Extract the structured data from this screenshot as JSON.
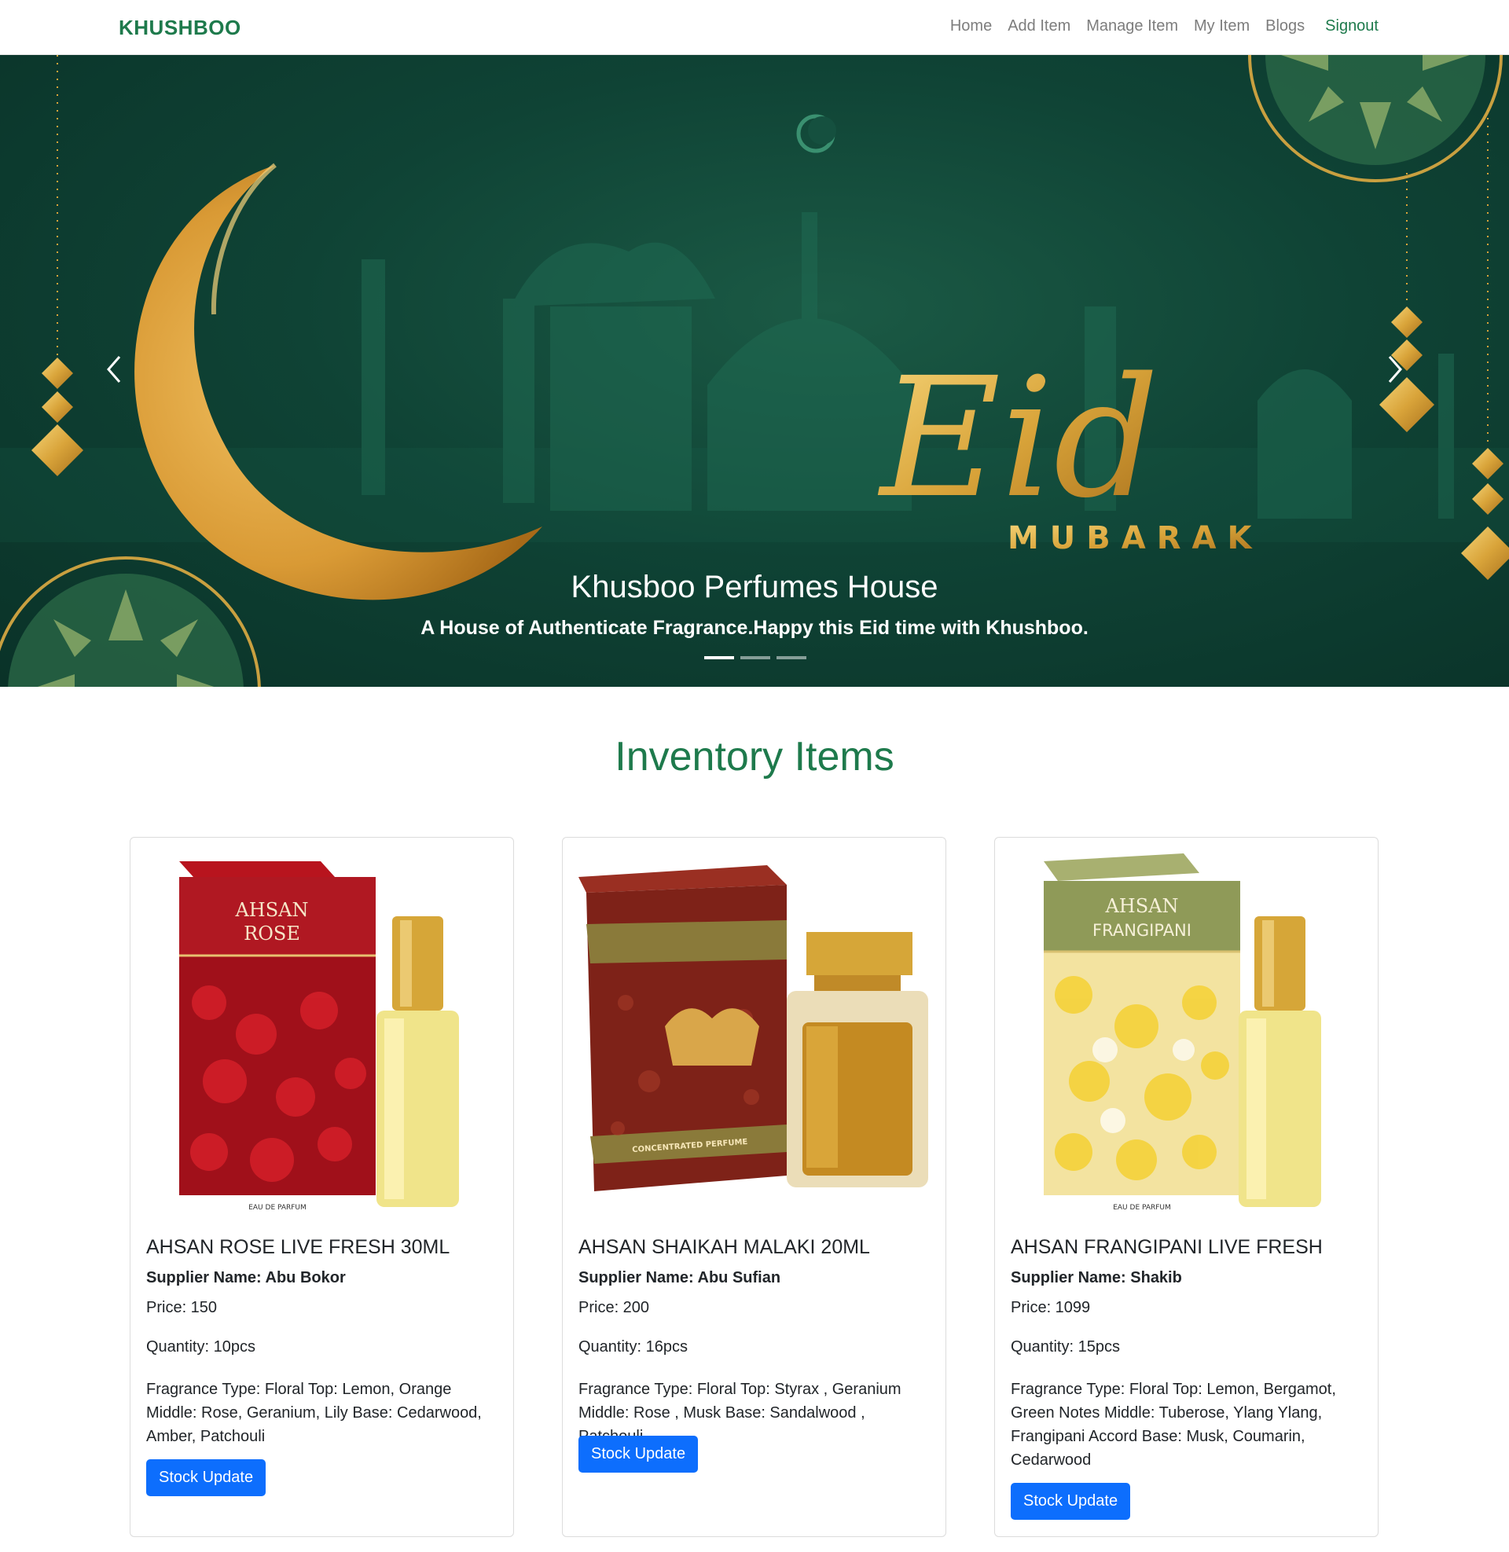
{
  "navbar": {
    "brand": "KHUSHBOO",
    "links": [
      "Home",
      "Add Item",
      "Manage Item",
      "My Item",
      "Blogs"
    ],
    "signout": "Signout"
  },
  "hero": {
    "banner_text_script": "Eid",
    "banner_text_caps": "MUBARAK",
    "caption_title": "Khusboo Perfumes House",
    "caption_subtitle": "A House of Authenticate Fragrance.Happy this Eid time with Khushboo.",
    "slide_count": 3,
    "active_slide": 1,
    "colors": {
      "background": "#0f4335",
      "gold": "#d9a43a"
    }
  },
  "inventory": {
    "title": "Inventory Items",
    "items": [
      {
        "name": "AHSAN ROSE LIVE FRESH 30ML",
        "supplier": "Supplier Name: Abu Bokor",
        "price": "Price: 150",
        "quantity": "Quantity: 10pcs",
        "description": "Fragrance Type: Floral Top: Lemon, Orange Middle: Rose, Geranium, Lily Base: Cedarwood, Amber, Patchouli",
        "button": "Stock Update",
        "box_label_1": "AHSAN",
        "box_label_2": "ROSE",
        "box_footer": "EAU DE PARFUM"
      },
      {
        "name": "AHSAN SHAIKAH MALAKI 20ML",
        "supplier": "Supplier Name: Abu Sufian",
        "price": "Price: 200",
        "quantity": "Quantity: 16pcs",
        "description": "Fragrance Type: Floral Top: Styrax , Geranium Middle: Rose , Musk Base: Sandalwood , Patchouli.",
        "button": "Stock Update",
        "box_footer": "CONCENTRATED PERFUME"
      },
      {
        "name": "AHSAN FRANGIPANI LIVE FRESH",
        "supplier": "Supplier Name: Shakib",
        "price": "Price: 1099",
        "quantity": "Quantity: 15pcs",
        "description": "Fragrance Type: Floral Top: Lemon, Bergamot, Green Notes Middle: Tuberose, Ylang Ylang, Frangipani Accord Base: Musk, Coumarin, Cedarwood",
        "button": "Stock Update",
        "box_label_1": "AHSAN",
        "box_label_2": "FRANGIPANI",
        "box_footer": "EAU DE PARFUM"
      }
    ]
  }
}
